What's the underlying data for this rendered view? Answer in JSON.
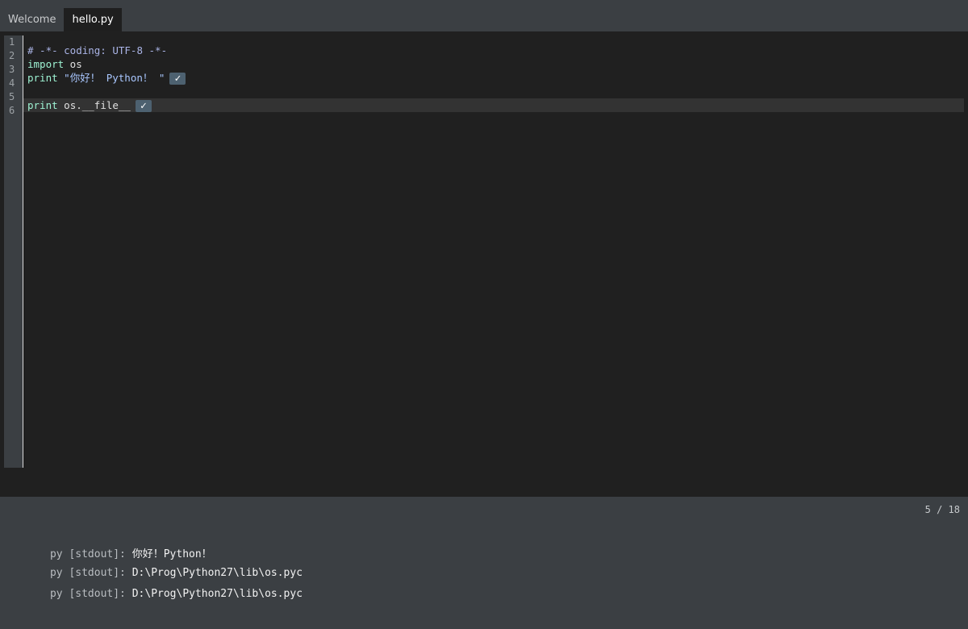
{
  "tabs": [
    {
      "label": "Welcome",
      "active": false
    },
    {
      "label": "hello.py",
      "active": true
    }
  ],
  "editor": {
    "line_numbers": [
      "1",
      "2",
      "3",
      "4",
      "5",
      "6"
    ],
    "current_line": 5,
    "lines": [
      {
        "tokens": [
          {
            "type": "comment",
            "text": "# -*- coding: UTF-8 -*-"
          }
        ]
      },
      {
        "tokens": [
          {
            "type": "keyword",
            "text": "import"
          },
          {
            "type": "plain",
            "text": " os"
          }
        ]
      },
      {
        "tokens": [
          {
            "type": "keyword",
            "text": "print"
          },
          {
            "type": "string",
            "text": " \"你好！ Python！ \""
          }
        ],
        "check": true
      },
      {
        "tokens": []
      },
      {
        "tokens": [
          {
            "type": "keyword",
            "text": "print"
          },
          {
            "type": "plain",
            "text": " os.__file__"
          }
        ],
        "check": true
      },
      {
        "tokens": []
      }
    ],
    "check_glyph": "✓",
    "check_icon": "checkmark-icon"
  },
  "output": {
    "position": "5 / 18",
    "lines": [
      {
        "prefix": "py [stdout]:",
        "value": "你好！Python！"
      },
      {
        "prefix": "py [stdout]:",
        "value": "D:\\Prog\\Python27\\lib\\os.pyc"
      },
      {
        "prefix": "py [stdout]:",
        "value": "D:\\Prog\\Python27\\lib\\os.pyc"
      }
    ]
  },
  "colors": {
    "editor_background": "#202020",
    "panel_background": "#3b3f43",
    "keyword": "#9ef3d3",
    "comment": "#aab4e6",
    "string": "#a9c7ff",
    "current_line": "#333333"
  }
}
